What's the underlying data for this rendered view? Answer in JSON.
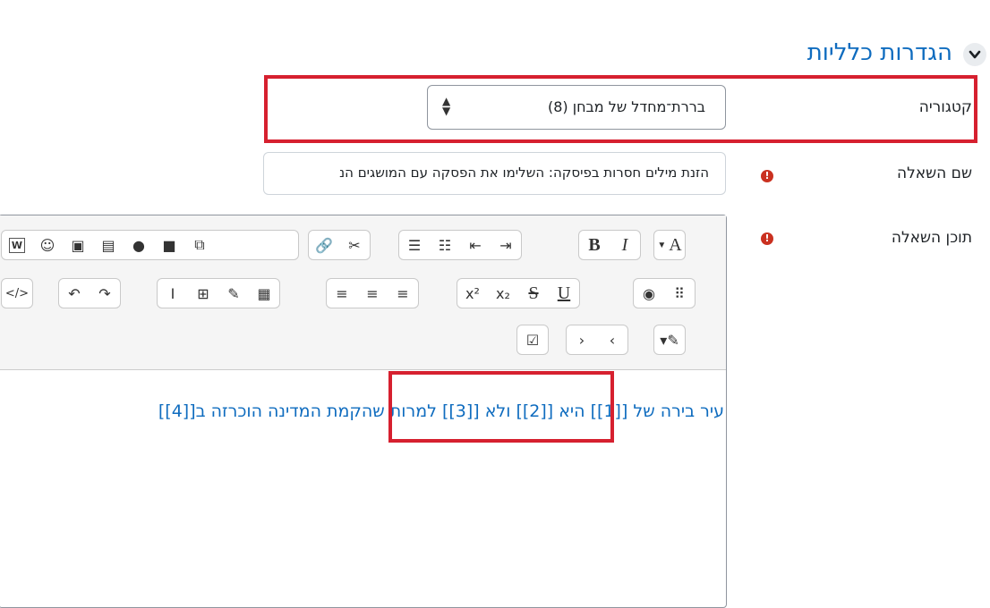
{
  "section": {
    "title": "הגדרות כלליות"
  },
  "category": {
    "label": "קטגוריה",
    "value": "בררת־מחדל של מבחן (8)"
  },
  "question_name": {
    "label": "שם השאלה",
    "value": "הזנת מילים חסרות בפיסקה: השלימו את הפסקה עם המושגים הנ"
  },
  "question_text": {
    "label": "תוכן השאלה",
    "content": "עיר בירה של [[1]] היא [[2]] ולא [[3]] למרות שהקמת המדינה הוכרזה ב[[4]]"
  },
  "toolbar": {
    "bold": "B",
    "italic": "I",
    "underline": "U",
    "strike": "S",
    "superscript": "x²",
    "subscript": "x₂",
    "paragraph": "A",
    "word": "W"
  },
  "colors": {
    "accent": "#0f6cbf",
    "required": "#ca3120",
    "highlight": "#d6202f"
  }
}
